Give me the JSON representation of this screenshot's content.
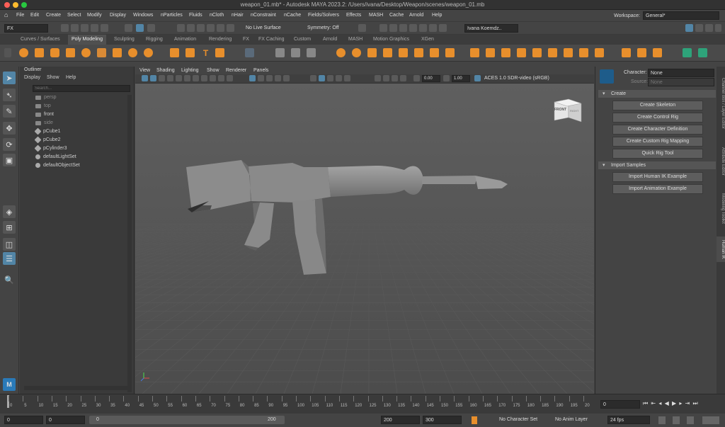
{
  "window": {
    "title": "weapon_01.mb* - Autodesk MAYA 2023.2: /Users/ivana/Desktop/Weapon/scenes/weapon_01.mb"
  },
  "menu": [
    "File",
    "Edit",
    "Create",
    "Select",
    "Modify",
    "Display",
    "Windows",
    "nParticles",
    "Fluids",
    "nCloth",
    "nHair",
    "nConstraint",
    "nCache",
    "Fields/Solvers",
    "Effects",
    "MASH",
    "Cache",
    "Arnold",
    "Help"
  ],
  "workspace": {
    "label": "Workspace:",
    "value": "General*"
  },
  "status": {
    "mode": "FX",
    "live": "No Live Surface",
    "symmetry": "Symmetry: Off",
    "user": "Ivana Koemdz.."
  },
  "shelf_tabs": [
    "Curves / Surfaces",
    "Poly Modeling",
    "Sculpting",
    "Rigging",
    "Animation",
    "Rendering",
    "FX",
    "FX Caching",
    "Custom",
    "Arnold",
    "MASH",
    "Motion Graphics",
    "XGen"
  ],
  "shelf_active": "Poly Modeling",
  "outliner": {
    "title": "Outliner",
    "menu": [
      "Display",
      "Show",
      "Help"
    ],
    "search_placeholder": "Search...",
    "items": [
      "persp",
      "top",
      "front",
      "side",
      "pCube1",
      "pCube2",
      "pCylinder3",
      "defaultLightSet",
      "defaultObjectSet"
    ]
  },
  "viewport": {
    "menu": [
      "View",
      "Shading",
      "Lighting",
      "Show",
      "Renderer",
      "Panels"
    ],
    "exposure": "0.00",
    "gamma": "1.00",
    "colorspace": "ACES 1.0 SDR-video (sRGB)",
    "viewcube_front": "FRONT",
    "viewcube_right": "RIGHT"
  },
  "hik": {
    "character_label": "Character:",
    "character_value": "None",
    "source_label": "Source:",
    "source_value": "None",
    "create_section": "Create",
    "create_buttons": [
      "Create Skeleton",
      "Create Control Rig",
      "Create Character Definition",
      "Create Custom Rig Mapping",
      "Quick Rig Tool"
    ],
    "import_section": "Import Samples",
    "import_buttons": [
      "Import Human IK Example",
      "Import Animation Example"
    ]
  },
  "side_tabs": [
    "Channel Box / Layer Editor",
    "Attribute Editor",
    "Modeling Toolkit",
    "Human IK"
  ],
  "timeline": {
    "ticks": [
      "0",
      "5",
      "10",
      "15",
      "20",
      "25",
      "30",
      "35",
      "40",
      "45",
      "50",
      "55",
      "60",
      "65",
      "70",
      "75",
      "80",
      "85",
      "90",
      "95",
      "100",
      "105",
      "110",
      "115",
      "120",
      "125",
      "130",
      "135",
      "140",
      "145",
      "150",
      "155",
      "160",
      "165",
      "170",
      "175",
      "180",
      "185",
      "190",
      "195",
      "20"
    ],
    "current_frame": "0"
  },
  "range": {
    "start": "0",
    "inner_start": "0",
    "slider_start": "0",
    "slider_end": "200",
    "end": "200",
    "outer_end": "300",
    "character_set": "No Character Set",
    "anim_layer": "No Anim Layer",
    "fps": "24 fps"
  },
  "colors": {
    "accent": "#e88f2c",
    "highlight": "#5285a6",
    "grid": "#5b5b5b"
  }
}
